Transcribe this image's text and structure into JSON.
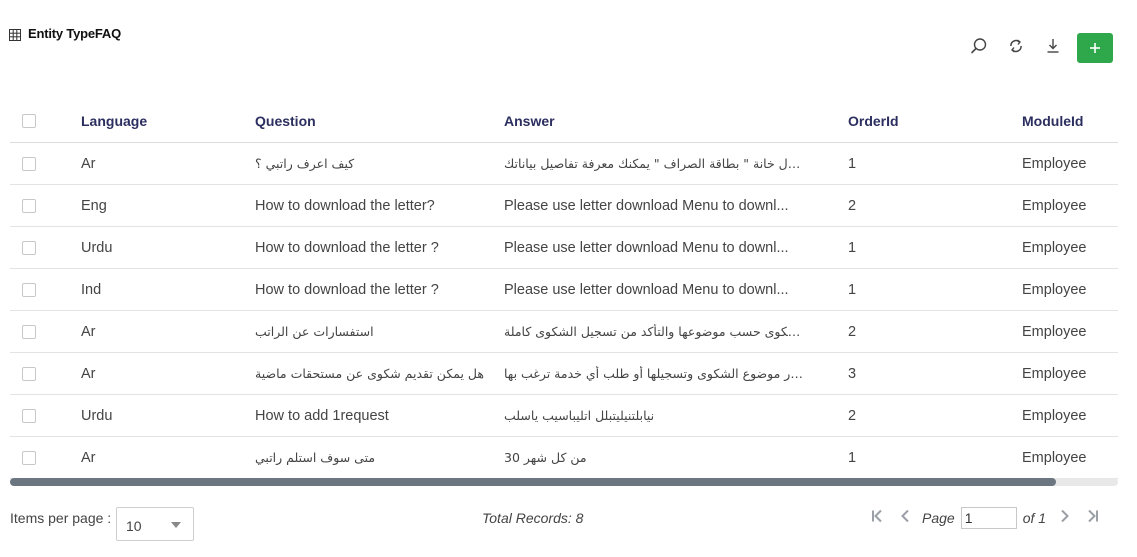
{
  "header": {
    "title": "Entity TypeFAQ"
  },
  "toolbar": {
    "add_label": "+"
  },
  "table": {
    "columns": [
      "Language",
      "Question",
      "Answer",
      "OrderId",
      "ModuleId"
    ],
    "rows": [
      {
        "language": "Ar",
        "question": "كيف اعرف راتبي ؟",
        "answer": "من خلال خانة \" بطاقة الصراف \" يمكنك معرفة تفاصيل بياناتك",
        "order": "1",
        "module": "Employee"
      },
      {
        "language": "Eng",
        "question": "How to download the letter?",
        "answer": "Please use letter download Menu to downl...",
        "order": "2",
        "module": "Employee"
      },
      {
        "language": "Urdu",
        "question": "How to download the letter ?",
        "answer": "Please use letter download Menu to downl...",
        "order": "1",
        "module": "Employee"
      },
      {
        "language": "Ind",
        "question": "How to download the letter ?",
        "answer": "Please use letter download Menu to downl...",
        "order": "1",
        "module": "Employee"
      },
      {
        "language": "Ar",
        "question": "استفسارات عن الراتب",
        "answer": "يتم تصنيف الشكوى حسب موضوعها والتأكد من تسجيل الشكوى كاملة",
        "order": "2",
        "module": "Employee"
      },
      {
        "language": "Ar",
        "question": "هل يمكن تقديم شكوى عن مستحقات ماضية",
        "answer": "يمكنك اختيار موضوع الشكوى وتسجيلها أو طلب أي خدمة ترغب بها",
        "order": "3",
        "module": "Employee"
      },
      {
        "language": "Urdu",
        "question": "How to add 1request",
        "answer": "نيابلتنيليتبلل اتليباسيب ياسلب",
        "order": "2",
        "module": "Employee"
      },
      {
        "language": "Ar",
        "question": "متى سوف استلم راتبي",
        "answer": "من كل شهر 30",
        "order": "1",
        "module": "Employee"
      }
    ]
  },
  "footer": {
    "items_per_page_label": "Items per page :",
    "items_per_page_value": "10",
    "total_records": "Total Records: 8",
    "page_label": "Page",
    "page_value": "1",
    "of_label": "of 1"
  }
}
